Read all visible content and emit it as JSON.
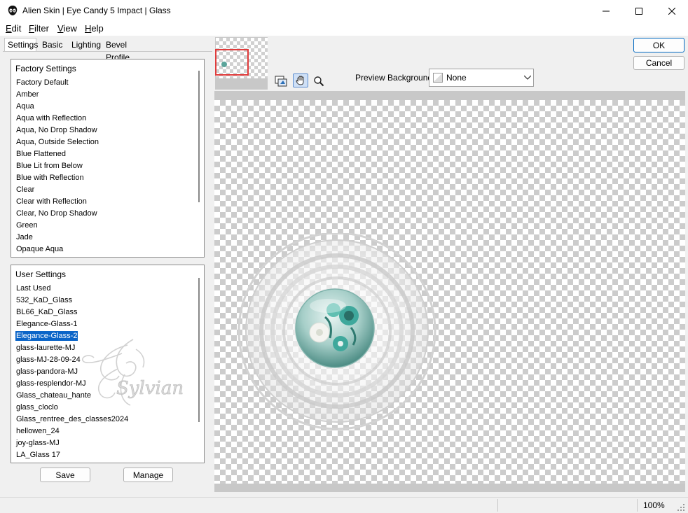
{
  "window": {
    "title": "Alien Skin | Eye Candy 5 Impact | Glass",
    "app_icon": "alien-skin-icon",
    "controls": [
      "minimize-icon",
      "maximize-icon",
      "close-icon"
    ]
  },
  "menu": {
    "items": [
      {
        "label": "Edit",
        "underline": "E",
        "rest": "dit"
      },
      {
        "label": "Filter",
        "underline": "F",
        "rest": "ilter"
      },
      {
        "label": "View",
        "underline": "V",
        "rest": "iew"
      },
      {
        "label": "Help",
        "underline": "H",
        "rest": "elp"
      }
    ]
  },
  "tabs": [
    {
      "label": "Settings",
      "active": true
    },
    {
      "label": "Basic",
      "active": false
    },
    {
      "label": "Lighting",
      "active": false
    },
    {
      "label": "Bevel Profile",
      "active": false
    }
  ],
  "factory_settings": {
    "header": "Factory Settings",
    "items": [
      "Factory Default",
      "Amber",
      "Aqua",
      "Aqua with Reflection",
      "Aqua, No Drop Shadow",
      "Aqua, Outside Selection",
      "Blue Flattened",
      "Blue Lit from Below",
      "Blue with Reflection",
      "Clear",
      "Clear with Reflection",
      "Clear, No Drop Shadow",
      "Green",
      "Jade",
      "Opaque Aqua"
    ]
  },
  "user_settings": {
    "header": "User Settings",
    "selected": "Elegance-Glass-2",
    "items": [
      "Last Used",
      "532_KaD_Glass",
      "BL66_KaD_Glass",
      "Elegance-Glass-1",
      "Elegance-Glass-2",
      "glass-laurette-MJ",
      "glass-MJ-28-09-24",
      "glass-pandora-MJ",
      "glass-resplendor-MJ",
      "Glass_chateau_hante",
      "glass_cloclo",
      "Glass_rentree_des_classes2024",
      "hellowen_24",
      "joy-glass-MJ",
      "LA_Glass 17"
    ]
  },
  "buttons": {
    "save": "Save",
    "manage": "Manage",
    "ok": "OK",
    "cancel": "Cancel"
  },
  "toolbar": {
    "tools": [
      "preview-toggle-icon",
      "hand-pan-icon",
      "zoom-icon"
    ]
  },
  "preview_background": {
    "label": "Preview Background:",
    "value": "None"
  },
  "watermark_text": "Sylviane",
  "status": {
    "zoom": "100%"
  },
  "colors": {
    "selection": "#0a64c8",
    "ok_border": "#0067c0",
    "navigator_frame": "#e03c3c",
    "glass_teal": "#3fa89c"
  }
}
